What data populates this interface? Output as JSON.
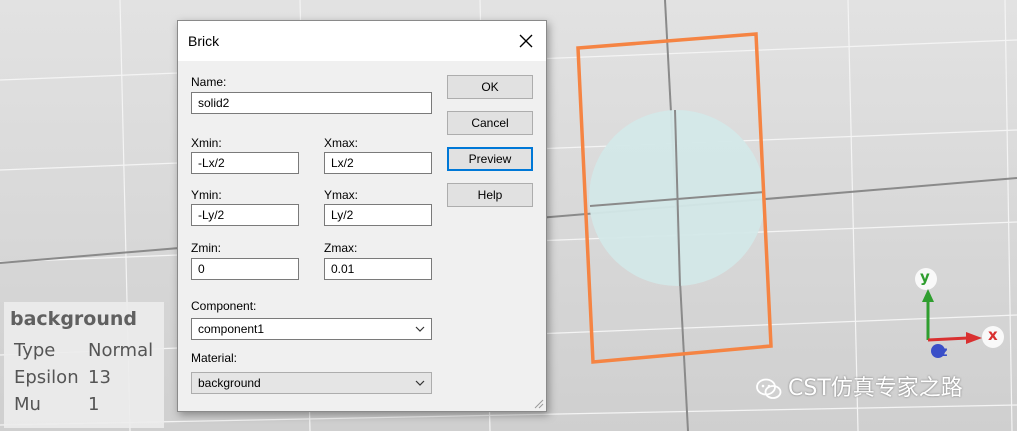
{
  "dialog": {
    "title": "Brick",
    "name_label": "Name:",
    "name_value": "solid2",
    "xmin_label": "Xmin:",
    "xmin_value": "-Lx/2",
    "xmax_label": "Xmax:",
    "xmax_value": "Lx/2",
    "ymin_label": "Ymin:",
    "ymin_value": "-Ly/2",
    "ymax_label": "Ymax:",
    "ymax_value": "Ly/2",
    "zmin_label": "Zmin:",
    "zmin_value": "0",
    "zmax_label": "Zmax:",
    "zmax_value": "0.01",
    "component_label": "Component:",
    "component_value": "component1",
    "material_label": "Material:",
    "material_value": "background",
    "buttons": {
      "ok": "OK",
      "cancel": "Cancel",
      "preview": "Preview",
      "help": "Help"
    }
  },
  "material_panel": {
    "title": "background",
    "rows": [
      {
        "key": "Type",
        "value": "Normal"
      },
      {
        "key": "Epsilon",
        "value": "13"
      },
      {
        "key": "Mu",
        "value": "1"
      }
    ]
  },
  "axes": {
    "x": "x",
    "y": "y",
    "z": "z"
  },
  "watermark": "CST仿真专家之路",
  "colors": {
    "brick_outline": "#f58443",
    "circle_fill": "#d3e8e8",
    "axis_x": "#d93030",
    "axis_y": "#2f9e2f",
    "axis_z": "#3a4fc8",
    "focus_border": "#0078d7"
  },
  "icons": [
    "close-icon",
    "chevron-down-icon",
    "resize-grip-icon",
    "wechat-icon"
  ]
}
